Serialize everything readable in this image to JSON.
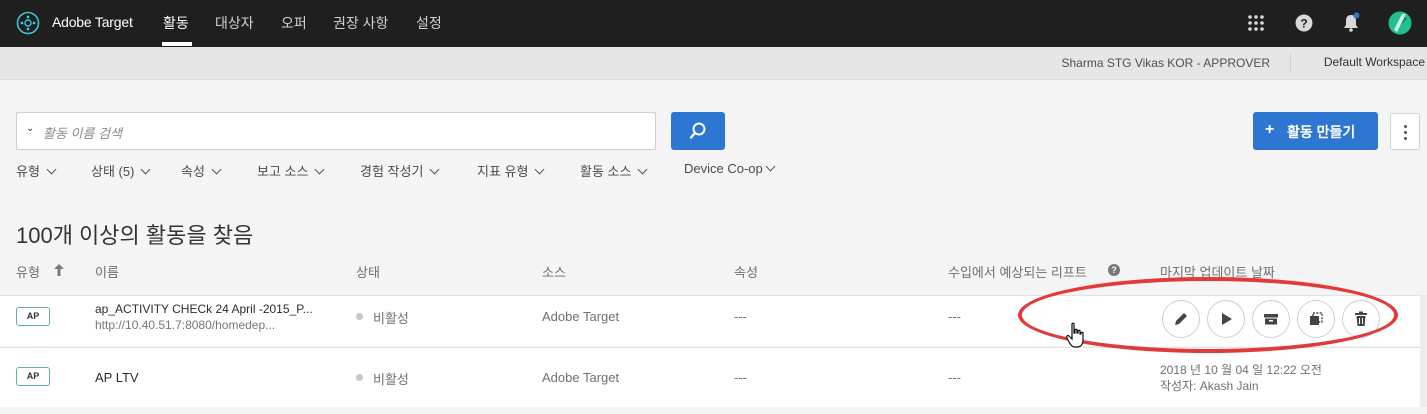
{
  "app": {
    "brand": "Adobe Target"
  },
  "nav": {
    "tabs": [
      {
        "label": "활동",
        "active": true
      },
      {
        "label": "대상자"
      },
      {
        "label": "오퍼"
      },
      {
        "label": "권장 사항"
      },
      {
        "label": "설정"
      }
    ],
    "icons": [
      "apps-grid-icon",
      "help-icon",
      "notifications-bell-icon",
      "user-avatar-icon"
    ]
  },
  "subbar": {
    "user": "Sharma STG Vikas KOR - APPROVER",
    "workspace": "Default Workspace"
  },
  "search": {
    "placeholder": "활동 이름 검색"
  },
  "toolbar": {
    "create_label": "활동 만들기",
    "create_plus": "+"
  },
  "filters": [
    "유형",
    "상태 (5)",
    "속성",
    "보고 소스",
    "경험 작성기",
    "지표 유형",
    "활동 소스",
    "Device Co-op"
  ],
  "results": {
    "summary": "100개 이상의 활동을 찾음"
  },
  "table": {
    "headers": [
      "유형",
      "이름",
      "상태",
      "소스",
      "속성",
      "수입에서 예상되는 리프트",
      "마지막 업데이트 날짜"
    ],
    "rows": [
      {
        "type": "AP",
        "name": "ap_ACTIVITY CHECk 24 April -2015_P...",
        "url": "http://10.40.51.7:8080/homedep...",
        "status": "비활성",
        "source": "Adobe Target",
        "property": "---",
        "lift": "---",
        "actions": [
          "edit-icon",
          "play-icon",
          "archive-icon",
          "copy-icon",
          "delete-icon"
        ]
      },
      {
        "type": "AP",
        "name": "AP LTV",
        "status": "비활성",
        "source": "Adobe Target",
        "property": "---",
        "lift": "---",
        "updated": "2018 년 10 월 04 일 12:22 오전",
        "author": "작성자: Akash Jain"
      }
    ]
  },
  "colors": {
    "topbar": "#1f1f1f",
    "primary": "#2d76d2",
    "badge_border": "#5fb0a8",
    "annotation": "#e23a3a",
    "avatar": "#1fbf8f"
  }
}
